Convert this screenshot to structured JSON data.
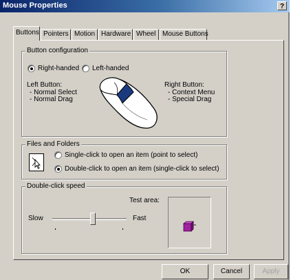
{
  "window": {
    "title": "Mouse Properties",
    "help_label": "?"
  },
  "tabs": [
    {
      "label": "Buttons",
      "active": true
    },
    {
      "label": "Pointers"
    },
    {
      "label": "Motion"
    },
    {
      "label": "Hardware"
    },
    {
      "label": "Wheel"
    },
    {
      "label": "Mouse Buttons"
    }
  ],
  "button_config": {
    "title": "Button configuration",
    "right_handed": "Right-handed",
    "left_handed": "Left-handed",
    "selected": "right",
    "left_button_title": "Left Button:",
    "left_items": [
      "- Normal Select",
      "- Normal Drag"
    ],
    "right_button_title": "Right Button:",
    "right_items": [
      "- Context Menu",
      "- Special Drag"
    ]
  },
  "files_folders": {
    "title": "Files and Folders",
    "single_click": "Single-click to open an item (point to select)",
    "double_click": "Double-click to open an item (single-click to select)",
    "selected": "double"
  },
  "double_click_speed": {
    "title": "Double-click speed",
    "test_area_label": "Test area:",
    "slow_label": "Slow",
    "fast_label": "Fast",
    "level": 0.55
  },
  "buttons": {
    "ok": "OK",
    "cancel": "Cancel",
    "apply": "Apply"
  },
  "colors": {
    "title_start": "#0a246a",
    "title_end": "#a6caf0",
    "face": "#d4d0c8",
    "mouse_accent": "#1a3a80",
    "test_box": "#a020a0"
  }
}
